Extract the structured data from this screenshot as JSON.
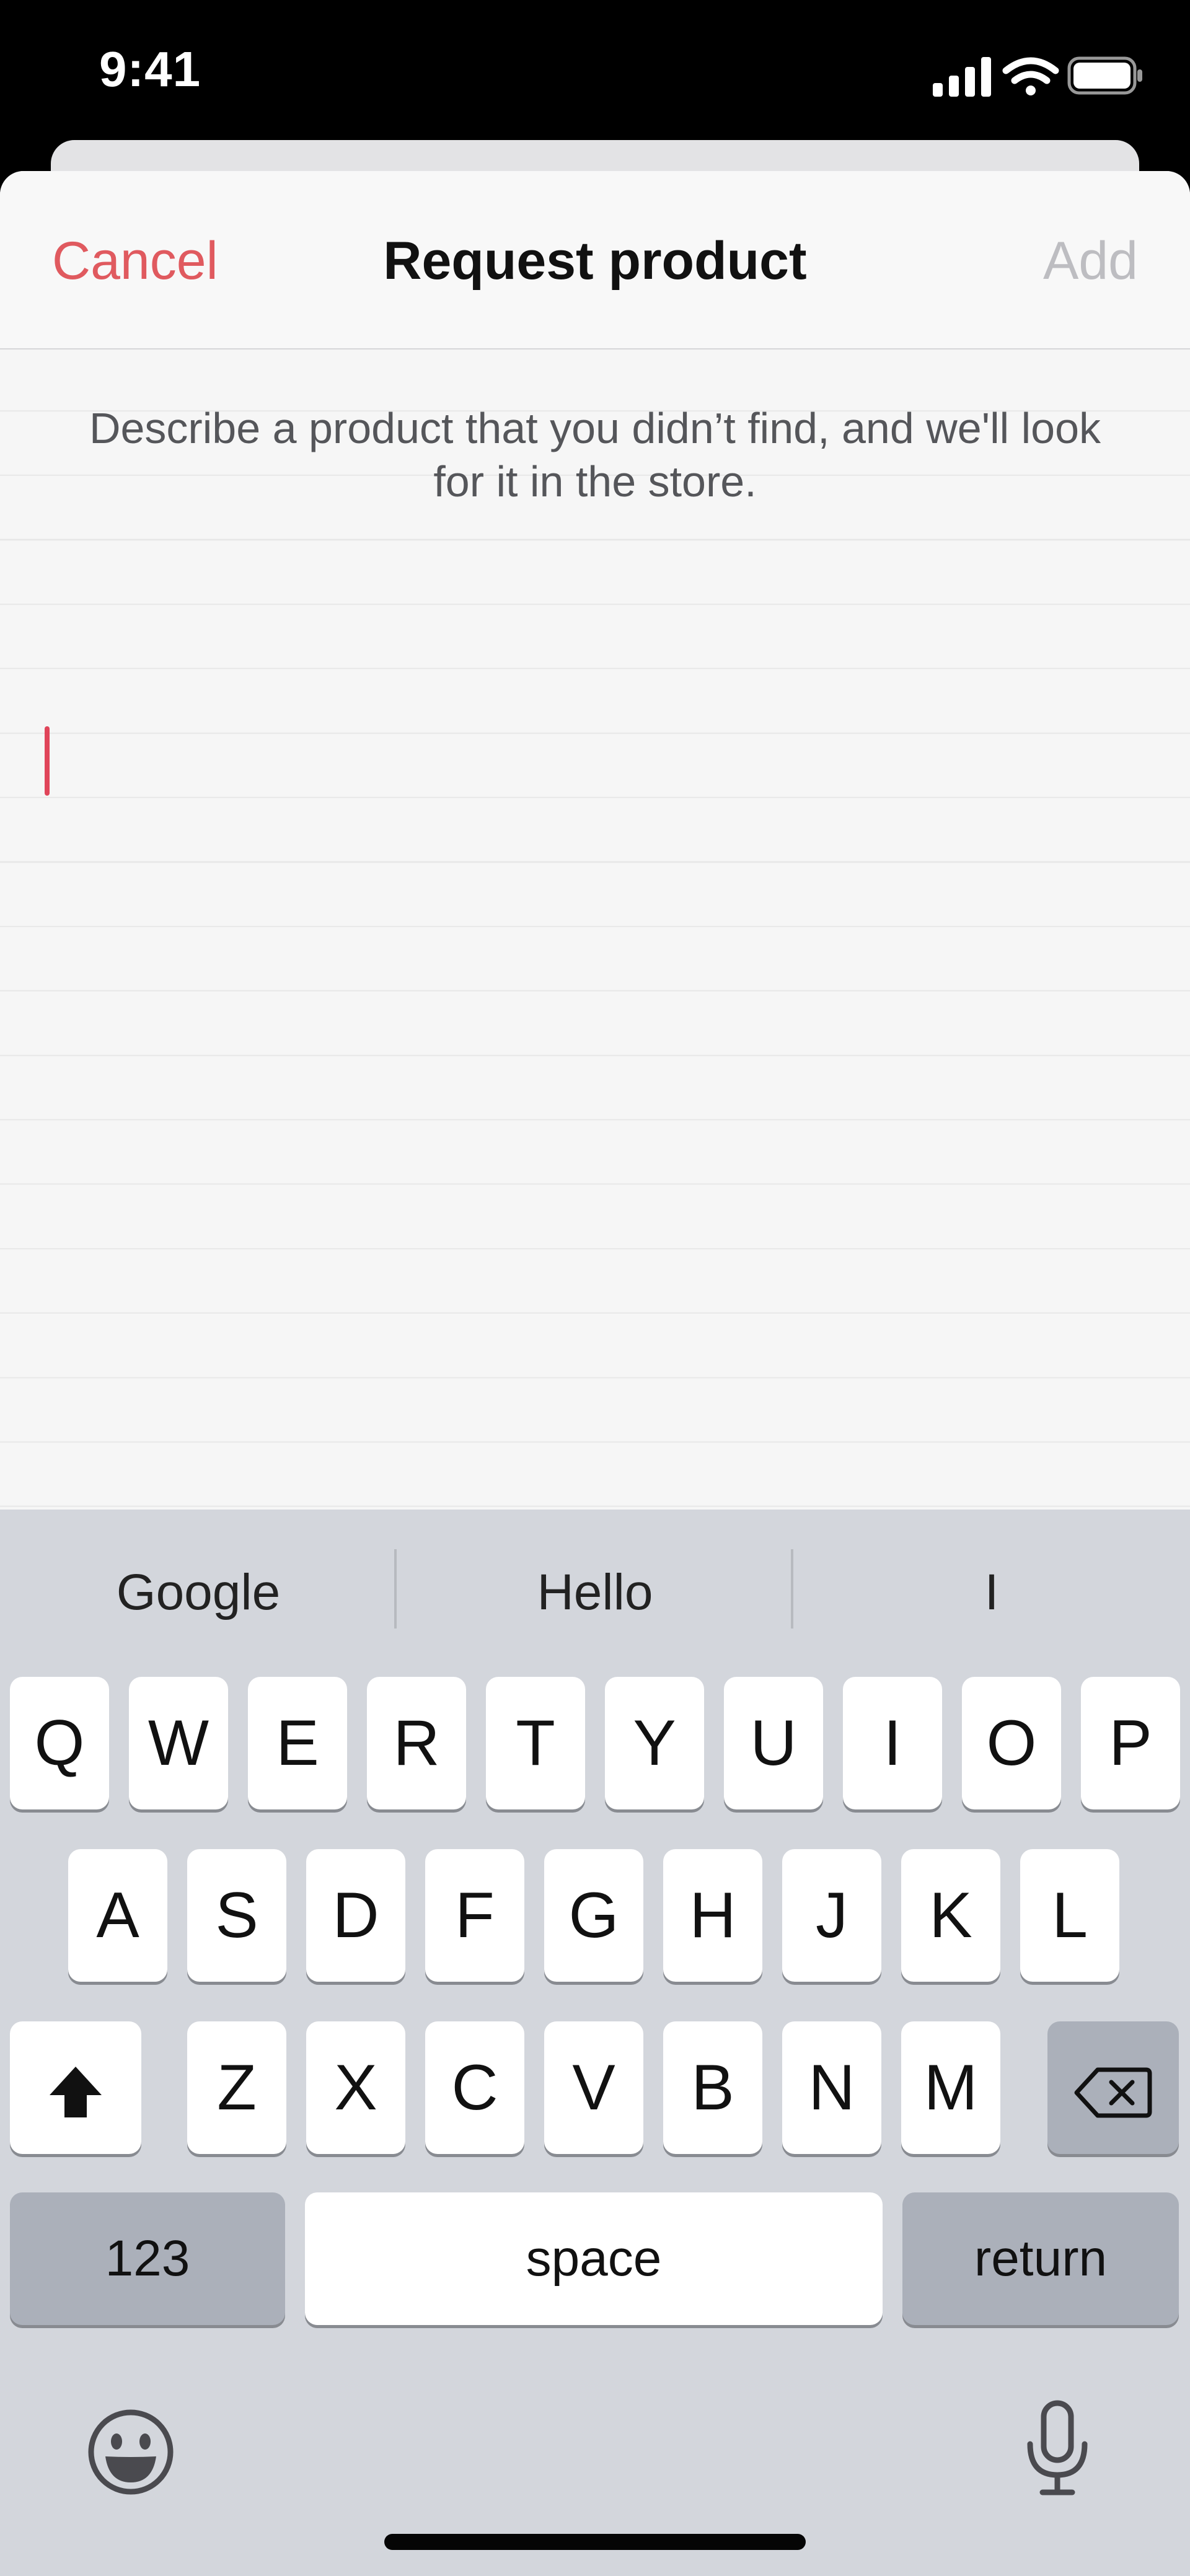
{
  "status_bar": {
    "time": "9:41"
  },
  "nav": {
    "cancel_label": "Cancel",
    "title": "Request product",
    "add_label": "Add"
  },
  "description": "Describe a product that you didn’t find, and we'll look for it in the store.",
  "input": {
    "value": ""
  },
  "colors": {
    "accent": "#e05a5f",
    "disabled": "#bdbdc1",
    "caret": "#e0455a",
    "keyboard_bg": "#d3d6dc"
  },
  "keyboard": {
    "suggestions": [
      "Google",
      "Hello",
      "I"
    ],
    "row1": [
      "Q",
      "W",
      "E",
      "R",
      "T",
      "Y",
      "U",
      "I",
      "O",
      "P"
    ],
    "row2": [
      "A",
      "S",
      "D",
      "F",
      "G",
      "H",
      "J",
      "K",
      "L"
    ],
    "row3": [
      "Z",
      "X",
      "C",
      "V",
      "B",
      "N",
      "M"
    ],
    "numbers_label": "123",
    "space_label": "space",
    "return_label": "return",
    "icons": [
      "shift-icon",
      "backspace-icon",
      "emoji-icon",
      "microphone-icon"
    ]
  }
}
